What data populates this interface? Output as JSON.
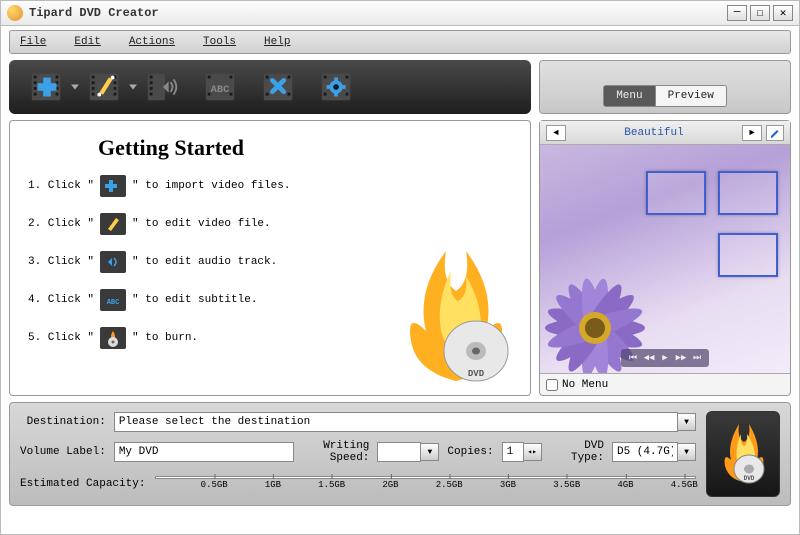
{
  "window": {
    "title": "Tipard DVD Creator"
  },
  "menubar": [
    "File",
    "Edit",
    "Actions",
    "Tools",
    "Help"
  ],
  "tabs": {
    "menu": "Menu",
    "preview": "Preview",
    "active": "preview"
  },
  "getting_started": {
    "heading": "Getting Started",
    "steps": [
      {
        "num": "1. Click \"",
        "after": "\" to import video files."
      },
      {
        "num": "2. Click \"",
        "after": "\" to edit video file."
      },
      {
        "num": "3. Click \"",
        "after": "\" to edit audio track."
      },
      {
        "num": "4. Click \"",
        "after": "\" to edit subtitle."
      },
      {
        "num": "5. Click \"",
        "after": "\" to burn."
      }
    ]
  },
  "preview": {
    "title": "Beautiful",
    "no_menu_label": "No Menu",
    "no_menu_checked": false
  },
  "settings": {
    "destination_label": "Destination:",
    "destination_value": "Please select the destination",
    "volume_label": "Volume Label:",
    "volume_value": "My DVD",
    "writing_speed_label": "Writing Speed:",
    "writing_speed_value": "",
    "copies_label": "Copies:",
    "copies_value": "1",
    "dvd_type_label": "DVD Type:",
    "dvd_type_value": "D5 (4.7G)",
    "capacity_label": "Estimated Capacity:",
    "capacity_ticks": [
      "0.5GB",
      "1GB",
      "1.5GB",
      "2GB",
      "2.5GB",
      "3GB",
      "3.5GB",
      "4GB",
      "4.5GB"
    ]
  }
}
